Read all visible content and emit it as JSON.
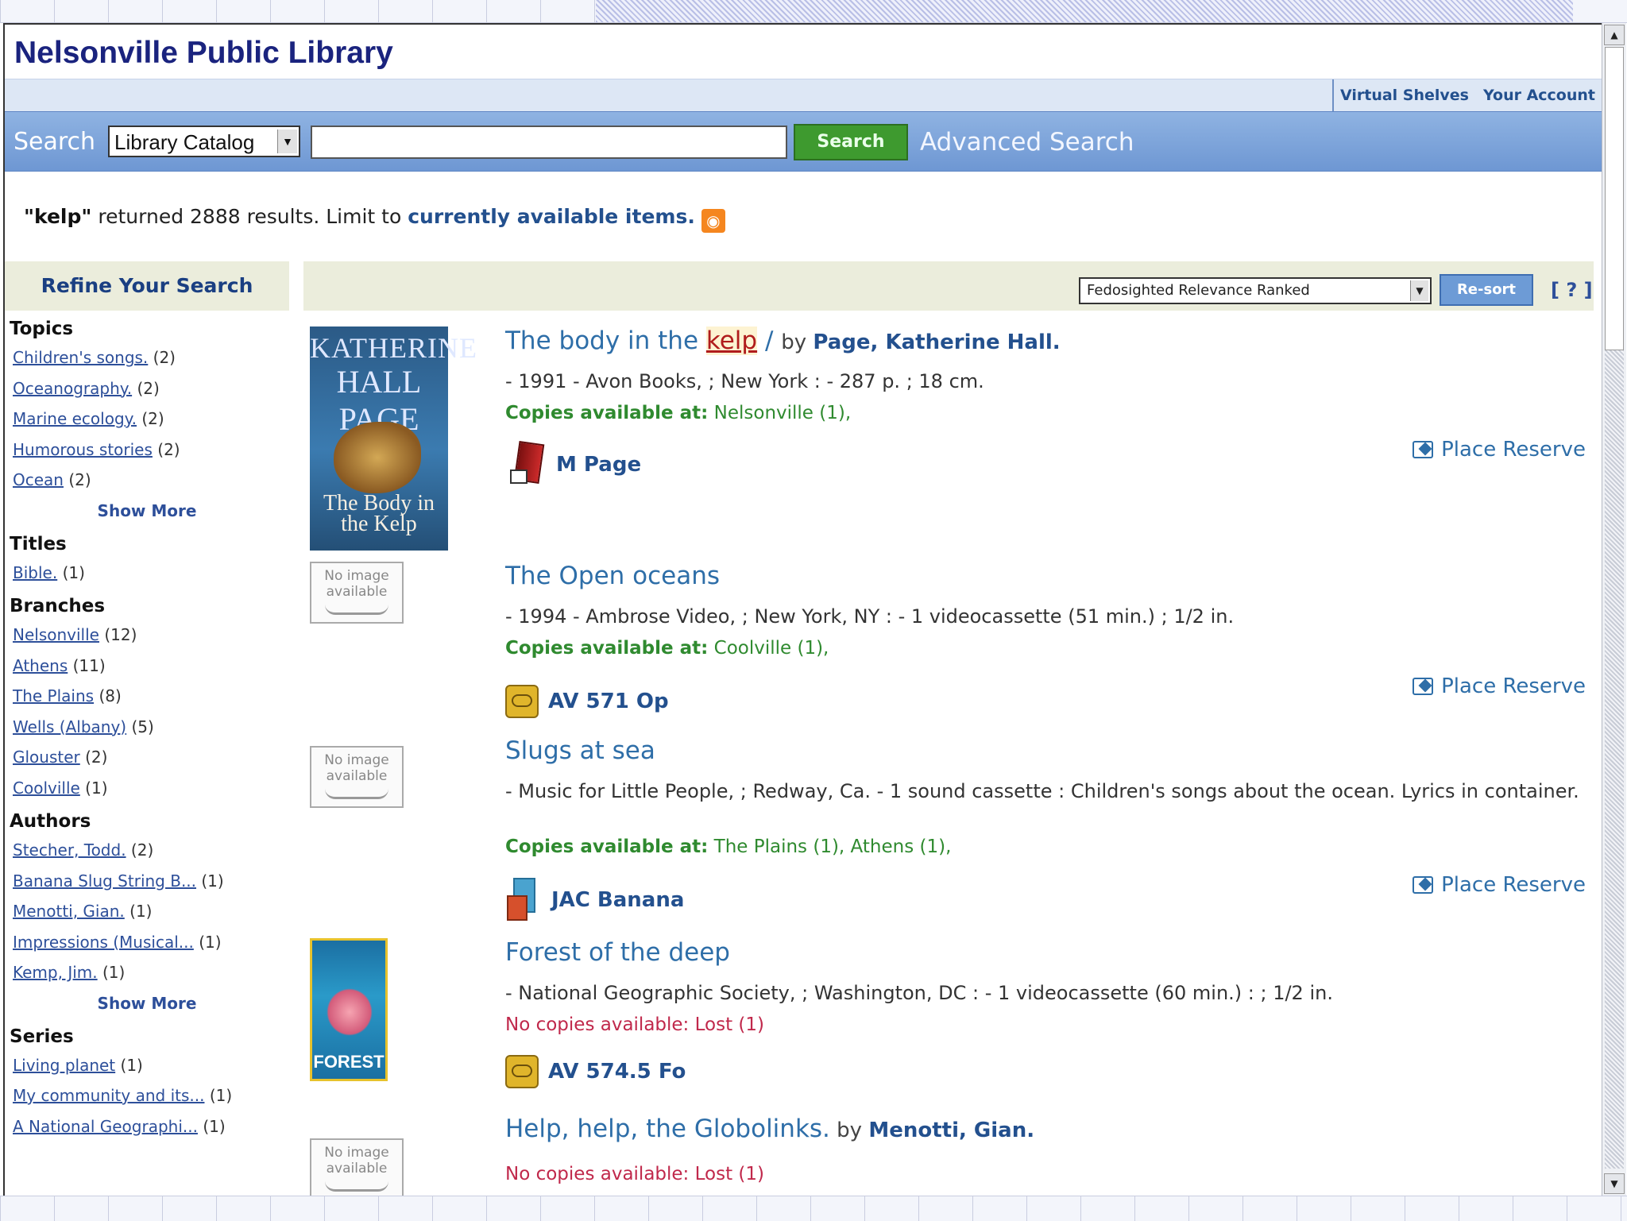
{
  "site": {
    "title": "Nelsonville Public Library",
    "account_links": [
      "Virtual Shelves",
      "Your Account"
    ]
  },
  "search": {
    "label": "Search",
    "scope": "Library Catalog",
    "query": "",
    "button": "Search",
    "advanced": "Advanced Search"
  },
  "summary": {
    "term": "\"kelp\"",
    "text": " returned 2888 results. Limit to ",
    "limit_link": "currently available items.",
    "rss_icon": "rss-icon"
  },
  "refine": {
    "title": "Refine Your Search",
    "show_more": "Show More",
    "facets": [
      {
        "heading": "Topics",
        "items": [
          {
            "label": "Children's songs.",
            "count": "(2)"
          },
          {
            "label": "Oceanography.",
            "count": "(2)"
          },
          {
            "label": "Marine ecology.",
            "count": "(2)"
          },
          {
            "label": "Humorous stories",
            "count": "(2)"
          },
          {
            "label": "Ocean",
            "count": "(2)"
          }
        ]
      },
      {
        "heading": "Titles",
        "items": [
          {
            "label": "Bible.",
            "count": "(1)"
          }
        ]
      },
      {
        "heading": "Branches",
        "items": [
          {
            "label": "Nelsonville",
            "count": "(12)"
          },
          {
            "label": "Athens",
            "count": "(11)"
          },
          {
            "label": "The Plains",
            "count": "(8)"
          },
          {
            "label": "Wells (Albany)",
            "count": "(5)"
          },
          {
            "label": "Glouster",
            "count": "(2)"
          },
          {
            "label": "Coolville",
            "count": "(1)"
          }
        ]
      },
      {
        "heading": "Authors",
        "items": [
          {
            "label": "Stecher, Todd.",
            "count": "(2)"
          },
          {
            "label": "Banana Slug String B...",
            "count": "(1)"
          },
          {
            "label": "Menotti, Gian.",
            "count": "(1)"
          },
          {
            "label": "Impressions (Musical...",
            "count": "(1)"
          },
          {
            "label": "Kemp, Jim.",
            "count": "(1)"
          }
        ]
      },
      {
        "heading": "Series",
        "items": [
          {
            "label": "Living planet",
            "count": "(1)"
          },
          {
            "label": "My community and its...",
            "count": "(1)"
          },
          {
            "label": "A National Geographi...",
            "count": "(1)"
          }
        ]
      }
    ]
  },
  "sort": {
    "selected": "Fedosighted Relevance Ranked",
    "button": "Re-sort",
    "help": "[ ? ]"
  },
  "records": [
    {
      "title_pre": "The body in the ",
      "title_hl": "kelp",
      "title_post": " / ",
      "by": "by ",
      "author": "Page, Katherine Hall.",
      "pub": "- 1991 - Avon Books, ; New York : - 287 p. ; 18 cm.",
      "copies_label": "Copies available at:",
      "copies_text": " Nelsonville (1),",
      "call": "M Page",
      "reserve": "Place Reserve",
      "cover": {
        "top": "KATHERINE",
        "mid": "HALL PAGE",
        "bottom": "The Body in the Kelp"
      }
    },
    {
      "title_pre": "The Open oceans",
      "pub": "- 1994 - Ambrose Video, ; New York, NY : - 1 videocassette (51 min.) ; 1/2 in.",
      "copies_label": "Copies available at:",
      "copies_text": " Coolville (1),",
      "call": "AV 571 Op",
      "reserve": "Place Reserve",
      "noimage": "No image available"
    },
    {
      "title_pre": "Slugs at sea",
      "pub": "- Music for Little People, ; Redway, Ca. - 1 sound cassette : Children's songs about the ocean. Lyrics in container.",
      "copies_label": "Copies available at:",
      "copies_text": " The Plains (1), Athens (1),",
      "call": "JAC Banana",
      "reserve": "Place Reserve",
      "noimage": "No image available"
    },
    {
      "title_pre": "Forest of the deep",
      "pub": "- National Geographic Society, ; Washington, DC : - 1 videocassette (60 min.) : ; 1/2 in.",
      "nocopies": "No copies available: Lost (1)",
      "call": "AV 574.5 Fo",
      "cover": {
        "footer": "FOREST"
      }
    },
    {
      "title_pre": "Help, help, the Globolinks.",
      "by": " by ",
      "author": "Menotti, Gian.",
      "nocopies": "No copies available: Lost (1)",
      "noimage": "No image available"
    }
  ],
  "colors": {
    "site_title": "#1a237e",
    "search_bar": "#7aa2d9",
    "search_button": "#3e9a2f",
    "link": "#23508e",
    "available": "#2f8a2f",
    "unavailable": "#c0284b",
    "refine_bg": "#ebeddc"
  }
}
